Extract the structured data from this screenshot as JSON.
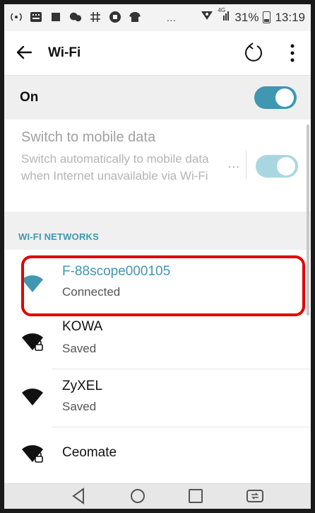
{
  "status_bar": {
    "network_type": "4G",
    "battery_percent": "31%",
    "time": "13:19",
    "overflow": "…",
    "icons": [
      "broadcast-icon",
      "keyboard-icon",
      "square-icon",
      "chat-bubbles-icon",
      "grid-icon",
      "shopping-icon",
      "shirt-icon"
    ]
  },
  "app_bar": {
    "title": "Wi-Fi",
    "back_icon": "arrow-left-icon",
    "refresh_icon": "refresh-icon",
    "more_icon": "more-vertical-icon"
  },
  "wifi_toggle": {
    "label": "On",
    "enabled": true,
    "color": "#3f97b1"
  },
  "mobile_data": {
    "title": "Switch to mobile data",
    "description": "Switch automatically to mobile data when Internet unavailable via Wi-Fi",
    "more": "…",
    "enabled": true,
    "dimmed": true
  },
  "networks": {
    "header": "WI-FI NETWORKS",
    "accent": "#3f97b1",
    "items": [
      {
        "name": "F-88scope000105",
        "status": "Connected",
        "secured": false,
        "connected": true
      },
      {
        "name": "KOWA",
        "status": "Saved",
        "secured": true,
        "connected": false
      },
      {
        "name": "ZyXEL",
        "status": "Saved",
        "secured": false,
        "connected": false
      },
      {
        "name": "Ceomate",
        "status": "",
        "secured": true,
        "connected": false
      }
    ],
    "highlight_color": "#e00000"
  },
  "nav_bar": {
    "icons": [
      "back-triangle-icon",
      "home-circle-icon",
      "recents-square-icon",
      "dual-window-icon"
    ]
  }
}
